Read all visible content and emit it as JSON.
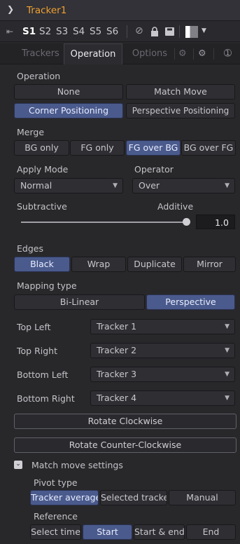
{
  "title": {
    "node_name": "Tracker1"
  },
  "toolbar": {
    "slots": [
      "S1",
      "S2",
      "S3",
      "S4",
      "S5",
      "S6"
    ],
    "active_slot": "S1"
  },
  "tabs": [
    {
      "label": "Trackers"
    },
    {
      "label": "Operation",
      "active": true
    },
    {
      "label": "Options"
    }
  ],
  "operation": {
    "label": "Operation",
    "options": [
      "None",
      "Match Move",
      "Corner Positioning",
      "Perspective Positioning"
    ],
    "selected": "Corner Positioning"
  },
  "merge": {
    "label": "Merge",
    "options": [
      "BG only",
      "FG only",
      "FG over BG",
      "BG over FG"
    ],
    "selected": "FG over BG"
  },
  "apply_mode": {
    "label": "Apply Mode",
    "value": "Normal"
  },
  "operator": {
    "label": "Operator",
    "value": "Over"
  },
  "subtractive_additive": {
    "left_label": "Subtractive",
    "right_label": "Additive",
    "value": "1.0"
  },
  "edges": {
    "label": "Edges",
    "options": [
      "Black",
      "Wrap",
      "Duplicate",
      "Mirror"
    ],
    "selected": "Black"
  },
  "mapping_type": {
    "label": "Mapping type",
    "options": [
      "Bi-Linear",
      "Perspective"
    ],
    "selected": "Perspective"
  },
  "corners": [
    {
      "label": "Top Left",
      "value": "Tracker 1"
    },
    {
      "label": "Top Right",
      "value": "Tracker 2"
    },
    {
      "label": "Bottom Left",
      "value": "Tracker 3"
    },
    {
      "label": "Bottom Right",
      "value": "Tracker 4"
    }
  ],
  "actions": {
    "rotate_cw": "Rotate Clockwise",
    "rotate_ccw": "Rotate Counter-Clockwise"
  },
  "match_move": {
    "label": "Match move settings",
    "pivot_type": {
      "label": "Pivot type",
      "options": [
        "Tracker average",
        "Selected tracker",
        "Manual"
      ],
      "selected": "Tracker average"
    },
    "reference": {
      "label": "Reference",
      "options": [
        "Select time",
        "Start",
        "Start & end",
        "End"
      ],
      "selected": "Start"
    }
  },
  "colors": {
    "accent_title": "#f0a030",
    "selected_button": "#4a5a8c",
    "background": "#28282b"
  }
}
